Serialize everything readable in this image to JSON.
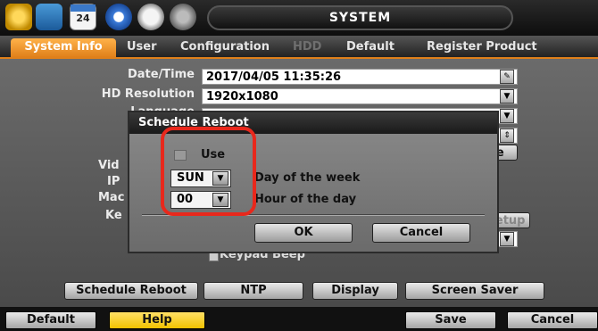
{
  "header": {
    "title": "SYSTEM",
    "calendar_day": "24"
  },
  "tabs": [
    {
      "label": "System Info",
      "active": true
    },
    {
      "label": "User"
    },
    {
      "label": "Configuration"
    },
    {
      "label": "HDD",
      "disabled": true
    },
    {
      "label": "Default"
    },
    {
      "label": "Register Product"
    }
  ],
  "fields": {
    "datetime": {
      "label": "Date/Time",
      "value": "2017/04/05 11:35:26"
    },
    "hd_resolution": {
      "label": "HD Resolution",
      "value": "1920x1080"
    },
    "language": {
      "label": "Language"
    },
    "partial_labels": [
      "Vid",
      "IP",
      "Mac",
      "Ke"
    ],
    "setup_button": "Setup",
    "partial_button_suffix": "le"
  },
  "keypad_beep": "Keypad Beep",
  "panel_buttons": [
    "Schedule Reboot",
    "NTP",
    "Display",
    "Screen Saver"
  ],
  "footer": {
    "default": "Default",
    "help": "Help",
    "save": "Save",
    "cancel": "Cancel"
  },
  "dialog": {
    "title": "Schedule Reboot",
    "use_label": "Use",
    "day_value": "SUN",
    "day_label": "Day of the week",
    "hour_value": "00",
    "hour_label": "Hour of the day",
    "ok": "OK",
    "cancel": "Cancel"
  },
  "colors": {
    "accent": "#e0801a",
    "highlight": "#e8281c",
    "help": "#f2c200"
  }
}
